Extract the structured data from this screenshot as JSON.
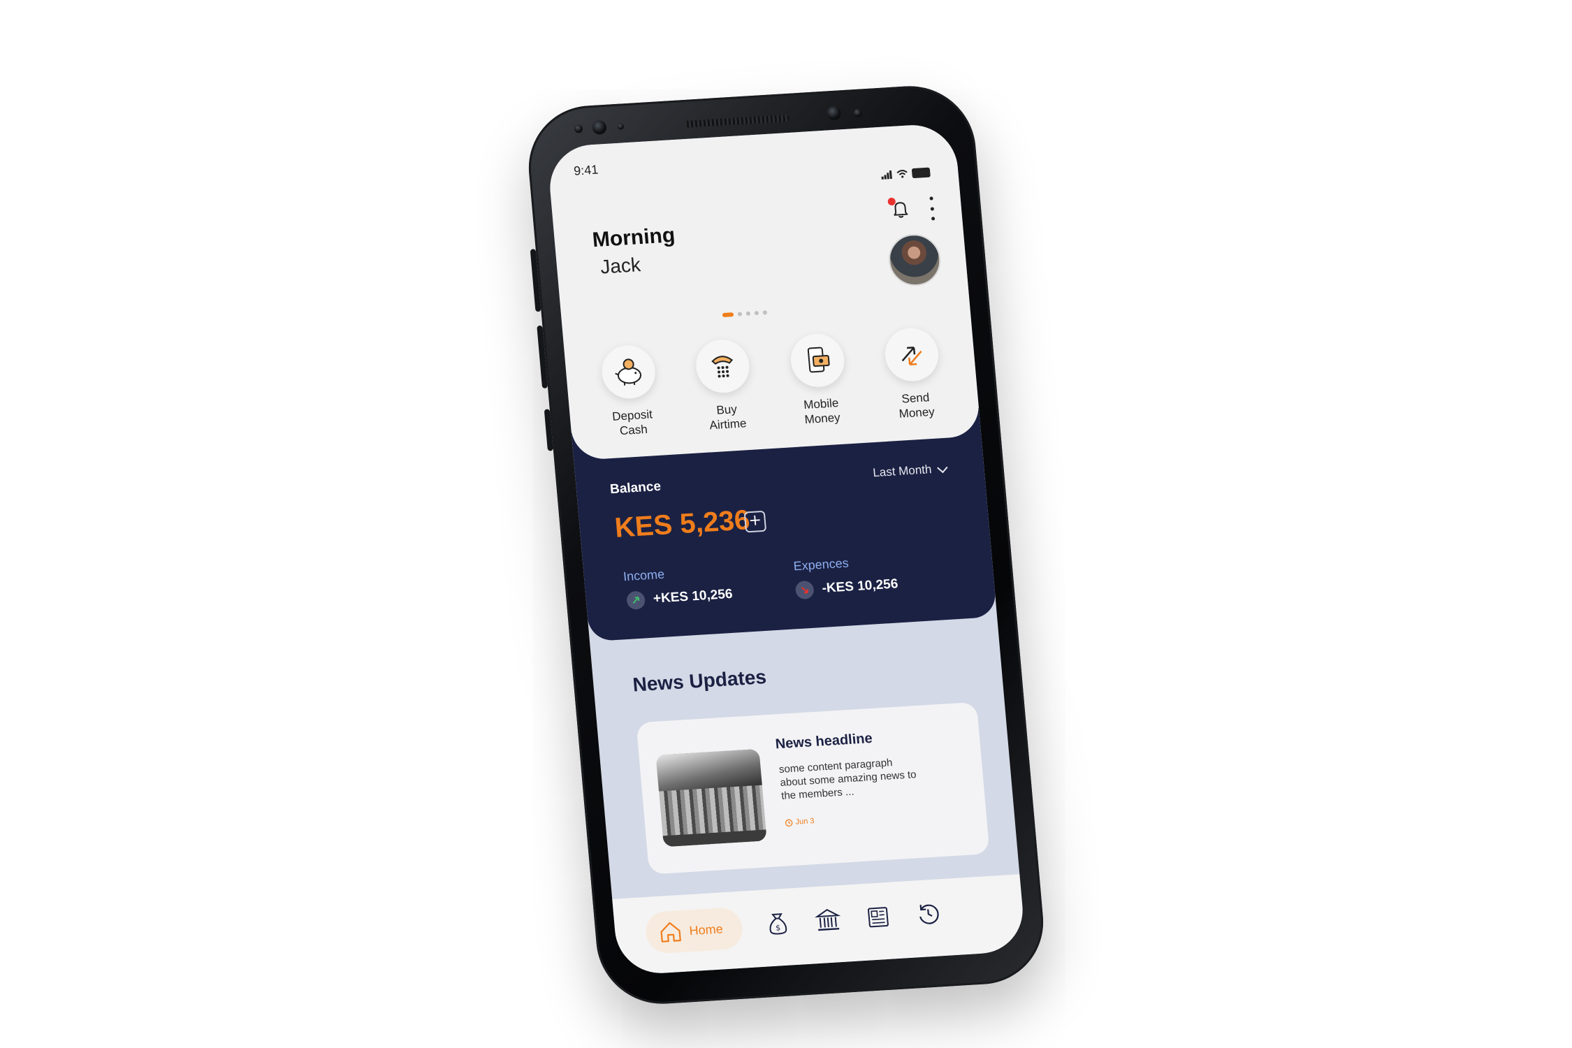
{
  "status_bar": {
    "time": "9:41"
  },
  "header": {
    "greeting": "Morning",
    "user_name": "Jack"
  },
  "carousel": {
    "pages": 5,
    "active": 0
  },
  "quick_actions": [
    {
      "label": "Deposit\nCash",
      "icon": "piggy-bank-icon"
    },
    {
      "label": "Buy\nAirtime",
      "icon": "phone-keypad-icon"
    },
    {
      "label": "Mobile\nMoney",
      "icon": "mobile-money-icon"
    },
    {
      "label": "Send\nMoney",
      "icon": "send-arrows-icon"
    }
  ],
  "balance": {
    "label": "Balance",
    "period": "Last Month",
    "amount": "KES 5,236",
    "add_symbol": "+",
    "income_label": "Income",
    "income_value": "+KES 10,256",
    "expenses_label": "Expences",
    "expenses_value": "-KES 10,256"
  },
  "news": {
    "section_title": "News Updates",
    "items": [
      {
        "headline": "News headline",
        "body": "some content paragraph about some amazing news to the members ...",
        "date": "Jun 3"
      }
    ]
  },
  "bottom_nav": {
    "home_label": "Home",
    "items": [
      "home-icon",
      "money-bag-icon",
      "bank-icon",
      "newspaper-icon",
      "history-icon"
    ]
  },
  "colors": {
    "accent": "#ef7d1c",
    "navy": "#1b2143",
    "light_bg": "#f1f1f1",
    "news_bg": "#d3d9e6"
  }
}
